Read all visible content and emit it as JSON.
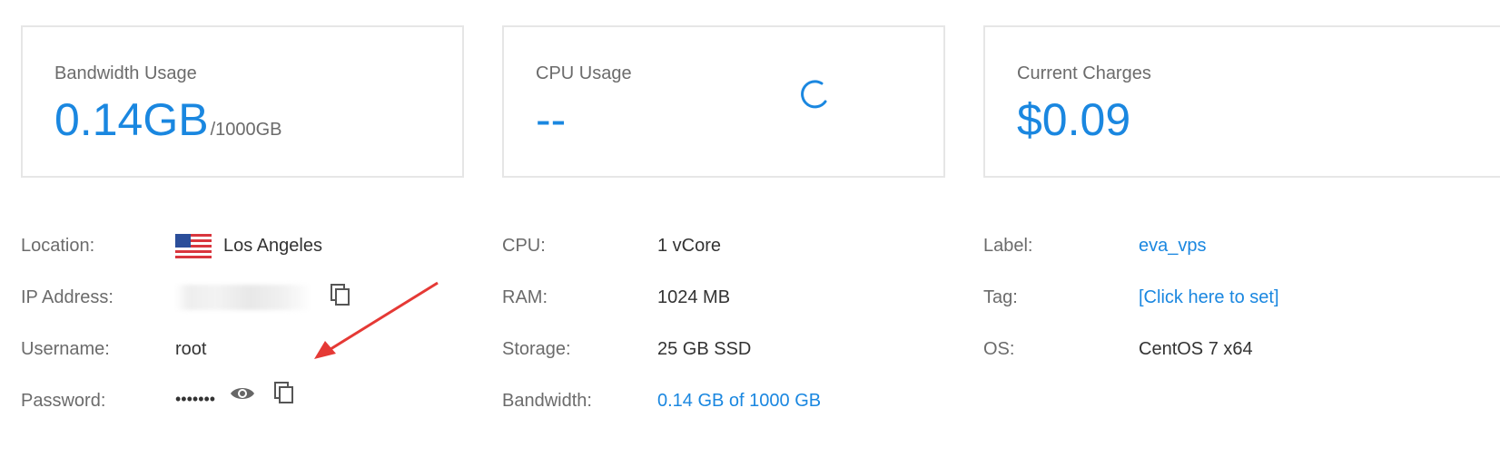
{
  "cards": [
    {
      "title": "Bandwidth Usage",
      "value": "0.14GB",
      "unit": "/1000GB"
    },
    {
      "title": "CPU Usage",
      "value": "--"
    },
    {
      "title": "Current Charges",
      "value": "$0.09"
    }
  ],
  "server": {
    "location_label": "Location:",
    "location_value": "Los Angeles",
    "ip_label": "IP Address:",
    "username_label": "Username:",
    "username_value": "root",
    "password_label": "Password:",
    "password_value": "•••••••"
  },
  "specs": {
    "cpu_label": "CPU:",
    "cpu_value": "1 vCore",
    "ram_label": "RAM:",
    "ram_value": "1024 MB",
    "storage_label": "Storage:",
    "storage_value": "25 GB SSD",
    "bandwidth_label": "Bandwidth:",
    "bandwidth_value": "0.14 GB of 1000 GB"
  },
  "meta": {
    "label_label": "Label:",
    "label_value": "eva_vps",
    "tag_label": "Tag:",
    "tag_value": "[Click here to set]",
    "os_label": "OS:",
    "os_value": "CentOS 7 x64"
  },
  "icons": {
    "flag": "us-flag-icon",
    "copy": "copy-icon",
    "eye": "eye-icon",
    "spinner": "loading-spinner-icon",
    "arrow": "red-arrow-annotation"
  },
  "colors": {
    "accent": "#1a87e0",
    "label": "#6b6b6b",
    "arrow": "#e53935"
  }
}
